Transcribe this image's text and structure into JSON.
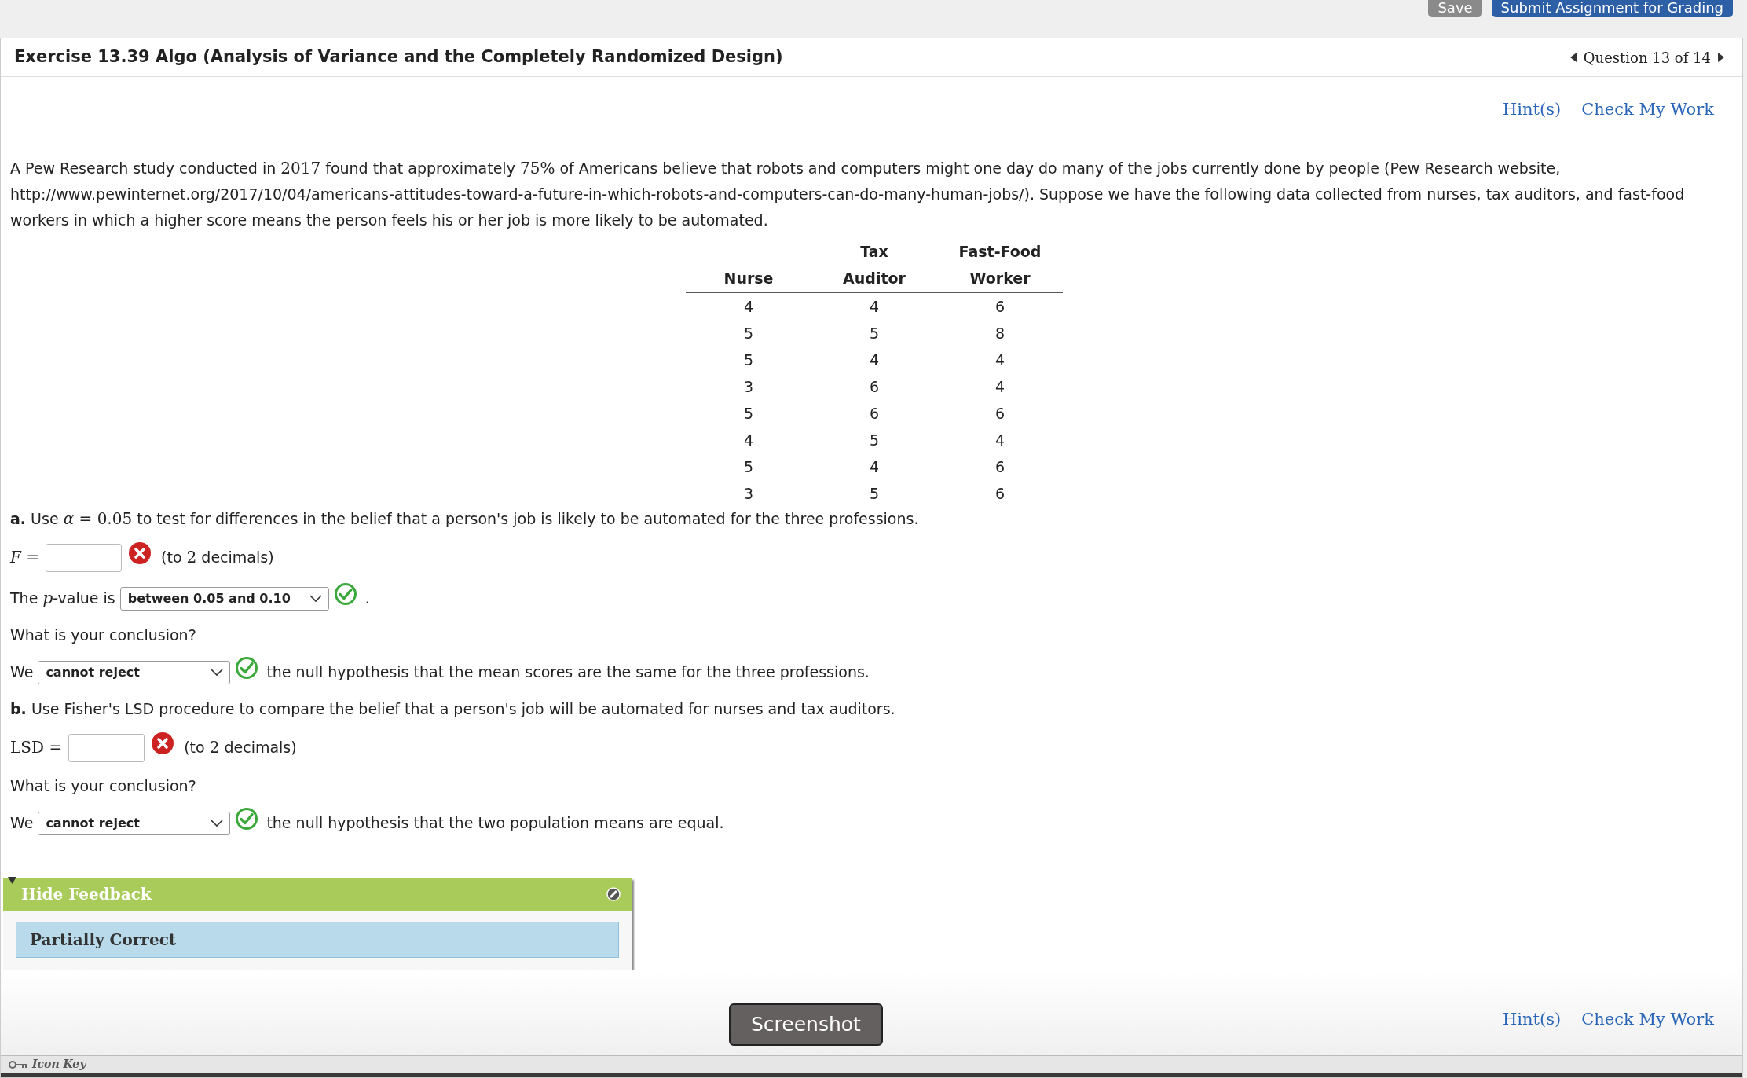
{
  "top_buttons": [
    {
      "label": "Save",
      "kind": "secondary"
    },
    {
      "label": "Submit Assignment for Grading",
      "kind": "primary"
    }
  ],
  "header": {
    "title": "Exercise 13.39 Algo (Analysis of Variance and the Completely Randomized Design)",
    "nav": "Question 13 of 14"
  },
  "links_top": [
    "Hint(s)",
    "Check My Work"
  ],
  "intro": [
    {
      "kind": "text",
      "t": "A Pew Research study conducted in "
    },
    {
      "kind": "math",
      "t": "2017"
    },
    {
      "kind": "text",
      "t": " found that approximately "
    },
    {
      "kind": "math",
      "t": "75%"
    },
    {
      "kind": "text",
      "t": " of Americans believe that robots and computers might one day do many of the jobs currently done by people (Pew Research website, http://www.pewinternet.org/2017/10/04/americans-attitudes-toward-a-future-in-which-robots-and-computers-can-do-many-human-jobs/). Suppose we have the following data collected from nurses, tax auditors, and fast-food workers in which a higher score means the person feels his or her job is more likely to be automated."
    }
  ],
  "table": {
    "header_rows": [
      [
        "",
        "Tax",
        "Fast-Food"
      ],
      [
        "Nurse",
        "Auditor",
        "Worker"
      ]
    ],
    "rows": [
      [
        "4",
        "4",
        "6"
      ],
      [
        "5",
        "5",
        "8"
      ],
      [
        "5",
        "4",
        "4"
      ],
      [
        "3",
        "6",
        "4"
      ],
      [
        "5",
        "6",
        "6"
      ],
      [
        "4",
        "5",
        "4"
      ],
      [
        "5",
        "4",
        "6"
      ],
      [
        "3",
        "5",
        "6"
      ]
    ]
  },
  "parts": [
    {
      "kind": "prompt",
      "label": "a.",
      "text": [
        {
          "kind": "text",
          "t": "Use "
        },
        {
          "kind": "math_italic",
          "t": "α"
        },
        {
          "kind": "math",
          "t": " = 0.05"
        },
        {
          "kind": "text",
          "t": " to test for differences in the belief that a person's job is likely to be automated for the three professions."
        }
      ]
    },
    {
      "kind": "numeric",
      "prefix": [
        {
          "kind": "math_italic",
          "t": "F"
        },
        {
          "kind": "math",
          "t": " ="
        }
      ],
      "correct": false,
      "suffix": [
        {
          "kind": "text",
          "t": "(to "
        },
        {
          "kind": "math",
          "t": "2"
        },
        {
          "kind": "text",
          "t": " decimals)"
        }
      ]
    },
    {
      "kind": "select",
      "prefix": [
        {
          "kind": "text",
          "t": "The "
        },
        {
          "kind": "math_italic",
          "t": "p"
        },
        {
          "kind": "text",
          "t": "-value is"
        }
      ],
      "value": "between 0.05 and 0.10",
      "correct": true,
      "suffix": [
        {
          "kind": "text",
          "t": "."
        }
      ]
    },
    {
      "kind": "text",
      "text": [
        {
          "kind": "text",
          "t": "What is your conclusion?"
        }
      ]
    },
    {
      "kind": "select",
      "prefix": [
        {
          "kind": "text",
          "t": "We"
        }
      ],
      "value": "cannot reject",
      "correct": true,
      "suffix": [
        {
          "kind": "text",
          "t": "the null hypothesis that the mean scores are the same for the three professions."
        }
      ]
    },
    {
      "kind": "prompt",
      "label": "b.",
      "text": [
        {
          "kind": "text",
          "t": "Use Fisher's LSD procedure to compare the belief that a person's job will be automated for nurses and tax auditors."
        }
      ]
    },
    {
      "kind": "numeric",
      "prefix": [
        {
          "kind": "math",
          "t": "LSD ="
        }
      ],
      "correct": false,
      "suffix": [
        {
          "kind": "text",
          "t": "(to "
        },
        {
          "kind": "math",
          "t": "2"
        },
        {
          "kind": "text",
          "t": " decimals)"
        }
      ]
    },
    {
      "kind": "text",
      "text": [
        {
          "kind": "text",
          "t": "What is your conclusion?"
        }
      ]
    },
    {
      "kind": "select",
      "prefix": [
        {
          "kind": "text",
          "t": "We"
        }
      ],
      "value": "cannot reject",
      "correct": true,
      "suffix": [
        {
          "kind": "text",
          "t": "the null hypothesis that the two population means are equal."
        }
      ]
    }
  ],
  "feedback": {
    "toggle": "Hide Feedback",
    "expanded": true,
    "message": "Partially Correct"
  },
  "links_bottom": [
    "Hint(s)",
    "Check My Work"
  ],
  "tooltip": "Screenshot",
  "footer": "Icon Key"
}
